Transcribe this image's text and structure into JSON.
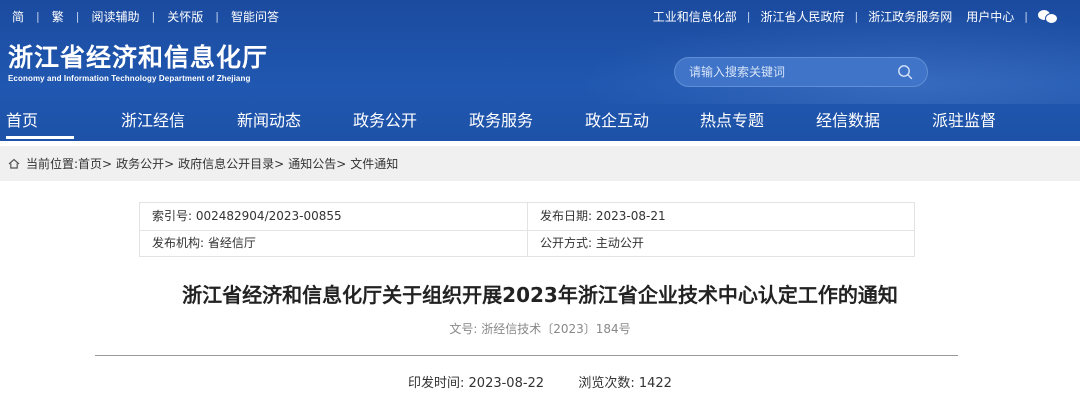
{
  "topbar": {
    "left_links": [
      "简",
      "繁",
      "阅读辅助",
      "关怀版",
      "智能问答"
    ],
    "right_links": [
      "工业和信息化部",
      "浙江省人民政府",
      "浙江政务服务网",
      "用户中心"
    ],
    "wechat_icon": "wechat-icon"
  },
  "logo": {
    "cn": "浙江省经济和信息化厅",
    "en": "Economy and Information Technology Department of Zhejiang"
  },
  "search": {
    "placeholder": "请输入搜索关键词",
    "icon": "search-icon"
  },
  "nav": {
    "items": [
      "首页",
      "浙江经信",
      "新闻动态",
      "政务公开",
      "政务服务",
      "政企互动",
      "热点专题",
      "经信数据",
      "派驻监督"
    ],
    "active": "首页"
  },
  "breadcrumb": {
    "icon": "home-icon",
    "prefix": "当前位置:",
    "items": [
      "首页>",
      "政务公开>",
      "政府信息公开目录>",
      "通知公告>",
      "文件通知"
    ]
  },
  "meta": {
    "index_no": "索引号: 002482904/2023-00855",
    "publish_date": "发布日期: 2023-08-21",
    "publisher": "发布机构: 省经信厅",
    "disclosure": "公开方式: 主动公开"
  },
  "article": {
    "title": "浙江省经济和信息化厅关于组织开展2023年浙江省企业技术中心认定工作的通知",
    "doc_no": "文号: 浙经信技术〔2023〕184号",
    "issue_time": "印发时间:  2023-08-22",
    "views": "浏览次数:  1422"
  },
  "colors": {
    "header_blue": "#1d4fa3",
    "breadcrumb_bg": "#f0f0f0",
    "search_bg": "#3f74c8"
  }
}
